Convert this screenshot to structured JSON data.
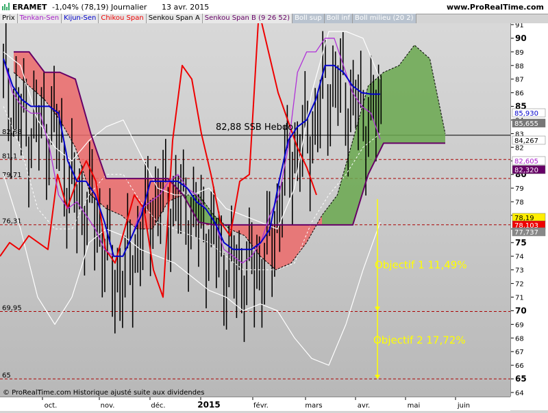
{
  "header": {
    "symbol": "ERAMET",
    "change": "-1,04% (78,19)",
    "period": "Journalier",
    "date": "13 avr. 2015",
    "site": "www.ProRealTime.com"
  },
  "legend": [
    {
      "label": "Prix",
      "color": "#000000"
    },
    {
      "label": "Tenkan-Sen",
      "color": "#aa22cc"
    },
    {
      "label": "Kijun-Sen",
      "color": "#0000cc"
    },
    {
      "label": "Chikou Span",
      "color": "#ee0000"
    },
    {
      "label": "Senkou Span A",
      "color": "#000000"
    },
    {
      "label": "Senkou Span B (9 26 52)",
      "color": "#660066"
    },
    {
      "label": "Boll sup",
      "color": "#ffffff"
    },
    {
      "label": "Boll inf",
      "color": "#ffffff"
    },
    {
      "label": "Boll milieu (20 2)",
      "color": "#ffffff"
    }
  ],
  "footer_note": "© ProRealTime.com Historique ajusté suite aux dividendes",
  "colors": {
    "price": "#000000",
    "tenkan": "#b030d8",
    "kijun": "#0000cc",
    "chikou": "#ee0000",
    "spanB": "#660066",
    "cloud_bull": "#6aa84f",
    "cloud_bear": "#ec6a6a",
    "boll": "#ffffff",
    "target": "#ffff00",
    "ref_line": "#aa0000"
  },
  "chart_data": {
    "type": "line",
    "x_axis": {
      "labels": [
        "oct.",
        "nov.",
        "déc.",
        "2015",
        "févr.",
        "mars",
        "avr.",
        "mai",
        "juin"
      ],
      "bold_labels": [
        "2015"
      ]
    },
    "y_axis": {
      "min": 64,
      "max": 91,
      "ticks": [
        64,
        65,
        66,
        67,
        68,
        69,
        70,
        71,
        72,
        73,
        74,
        75,
        76,
        77,
        78,
        79,
        80,
        81,
        82,
        83,
        84,
        85,
        86,
        87,
        88,
        89,
        90,
        91
      ],
      "bold_ticks": [
        65,
        70,
        75,
        80,
        85,
        90
      ]
    },
    "last_price": 78.19,
    "horizontal_levels": [
      {
        "value": 82.88,
        "label": "82,88",
        "style": "solid"
      },
      {
        "value": 81.1,
        "label": "81,1",
        "style": "dashed"
      },
      {
        "value": 79.71,
        "label": "79,71",
        "style": "dashed"
      },
      {
        "value": 76.31,
        "label": "76,31",
        "style": "dashed"
      },
      {
        "value": 69.95,
        "label": "69,95",
        "style": "dashed"
      },
      {
        "value": 65.0,
        "label": "65",
        "style": "dashed"
      }
    ],
    "annotations": [
      {
        "text": "82,88 SSB Hebdo"
      },
      {
        "text": "Objectif 1   11,49%"
      },
      {
        "text": "Objectif 2   17,72%"
      }
    ],
    "value_boxes": [
      {
        "value": "85,930",
        "bg": "#ffffff",
        "fg": "#0000cc"
      },
      {
        "value": "85,655",
        "bg": "#777777",
        "fg": "#ffffff"
      },
      {
        "value": "84,267",
        "bg": "#ffffff",
        "fg": "#000000"
      },
      {
        "value": "82,605",
        "bg": "#ffffff",
        "fg": "#aa22cc"
      },
      {
        "value": "82,320",
        "bg": "#660066",
        "fg": "#ffffff"
      },
      {
        "value": "78,19",
        "bg": "#ffee00",
        "fg": "#000000"
      },
      {
        "value": "78,103",
        "bg": "#ee0000",
        "fg": "#ffffff"
      },
      {
        "value": "77,737",
        "bg": "#888888",
        "fg": "#ffffff"
      }
    ],
    "series": [
      {
        "name": "Tenkan-Sen",
        "values": [
          88.5,
          86.0,
          85.0,
          84.5,
          84.5,
          82.0,
          78.5,
          77.5,
          78.0,
          77.0,
          76.0,
          74.5,
          74.0,
          74.0,
          75.5,
          77.5,
          78.0,
          78.5,
          79.5,
          80.0,
          79.0,
          78.5,
          77.5,
          76.5,
          74.5,
          74.0,
          73.5,
          74.0,
          75.0,
          77.0,
          78.5,
          82.0,
          87.5,
          89.0,
          89.0,
          90.0,
          90.0,
          88.0,
          86.0,
          85.0,
          84.5,
          82.6
        ]
      },
      {
        "name": "Kijun-Sen",
        "values": [
          88.5,
          86.5,
          85.5,
          85.0,
          85.0,
          85.0,
          84.5,
          81.0,
          79.5,
          79.5,
          78.5,
          76.5,
          74.0,
          74.0,
          75.5,
          77.0,
          79.5,
          79.5,
          79.5,
          79.5,
          79.0,
          78.0,
          77.5,
          76.5,
          75.0,
          74.5,
          74.5,
          74.5,
          75.0,
          76.0,
          79.5,
          82.5,
          83.5,
          84.0,
          85.5,
          88.0,
          88.0,
          87.5,
          86.5,
          86.0,
          85.9,
          85.9
        ]
      },
      {
        "name": "Chikou Span",
        "values": [
          74.0,
          75.0,
          74.5,
          75.5,
          75.0,
          74.5,
          80.0,
          77.5,
          79.5,
          81.0,
          79.5,
          74.5,
          73.5,
          76.0,
          78.5,
          77.5,
          73.0,
          71.0,
          82.5,
          88.0,
          87.0,
          83.0,
          80.0,
          76.5,
          75.5,
          79.5,
          80.0,
          92.0,
          89.0,
          86.0,
          84.0,
          82.0,
          80.5,
          78.5
        ]
      },
      {
        "name": "Senkou Span B",
        "values": [
          89.0,
          89.0,
          87.5,
          87.5,
          87.0,
          83.0,
          79.7,
          79.7,
          79.7,
          79.7,
          79.7,
          78.5,
          76.5,
          76.3,
          76.3,
          76.3,
          76.3,
          76.3,
          76.3,
          76.3,
          76.3,
          76.3,
          76.3,
          80.0,
          82.3,
          82.3,
          82.3,
          82.3,
          82.3
        ]
      },
      {
        "name": "Senkou Span A",
        "values": [
          87.5,
          86.5,
          85.5,
          84.0,
          82.0,
          78.5,
          77.5,
          77.0,
          76.0,
          76.0,
          78.0,
          78.5,
          78.5,
          77.0,
          76.0,
          75.5,
          74.0,
          73.0,
          73.5,
          75.0,
          77.0,
          78.5,
          82.5,
          86.5,
          87.5,
          88.0,
          89.5,
          88.5,
          83.0
        ]
      },
      {
        "name": "Boll sup",
        "values": [
          89.0,
          88.0,
          84.0,
          82.0,
          81.0,
          82.5,
          83.5,
          84.0,
          81.5,
          79.0,
          78.5,
          78.5,
          79.0,
          77.5,
          77.0,
          76.5,
          76.0,
          79.0,
          86.0,
          90.5,
          90.5,
          90.0,
          87.0
        ]
      },
      {
        "name": "Boll inf",
        "values": [
          80.0,
          76.0,
          71.0,
          69.0,
          71.0,
          75.0,
          76.0,
          75.5,
          74.5,
          74.0,
          73.5,
          72.5,
          71.5,
          71.0,
          70.0,
          70.5,
          70.0,
          68.0,
          66.5,
          66.0,
          69.0,
          73.0,
          76.5
        ]
      },
      {
        "name": "Boll milieu",
        "values": [
          85.0,
          82.0,
          77.5,
          76.0,
          76.0,
          78.5,
          80.0,
          80.0,
          78.0,
          76.5,
          76.0,
          75.5,
          75.0,
          74.0,
          73.0,
          73.0,
          73.0,
          73.5,
          76.5,
          78.5,
          80.0,
          82.0,
          83.0
        ]
      }
    ]
  }
}
